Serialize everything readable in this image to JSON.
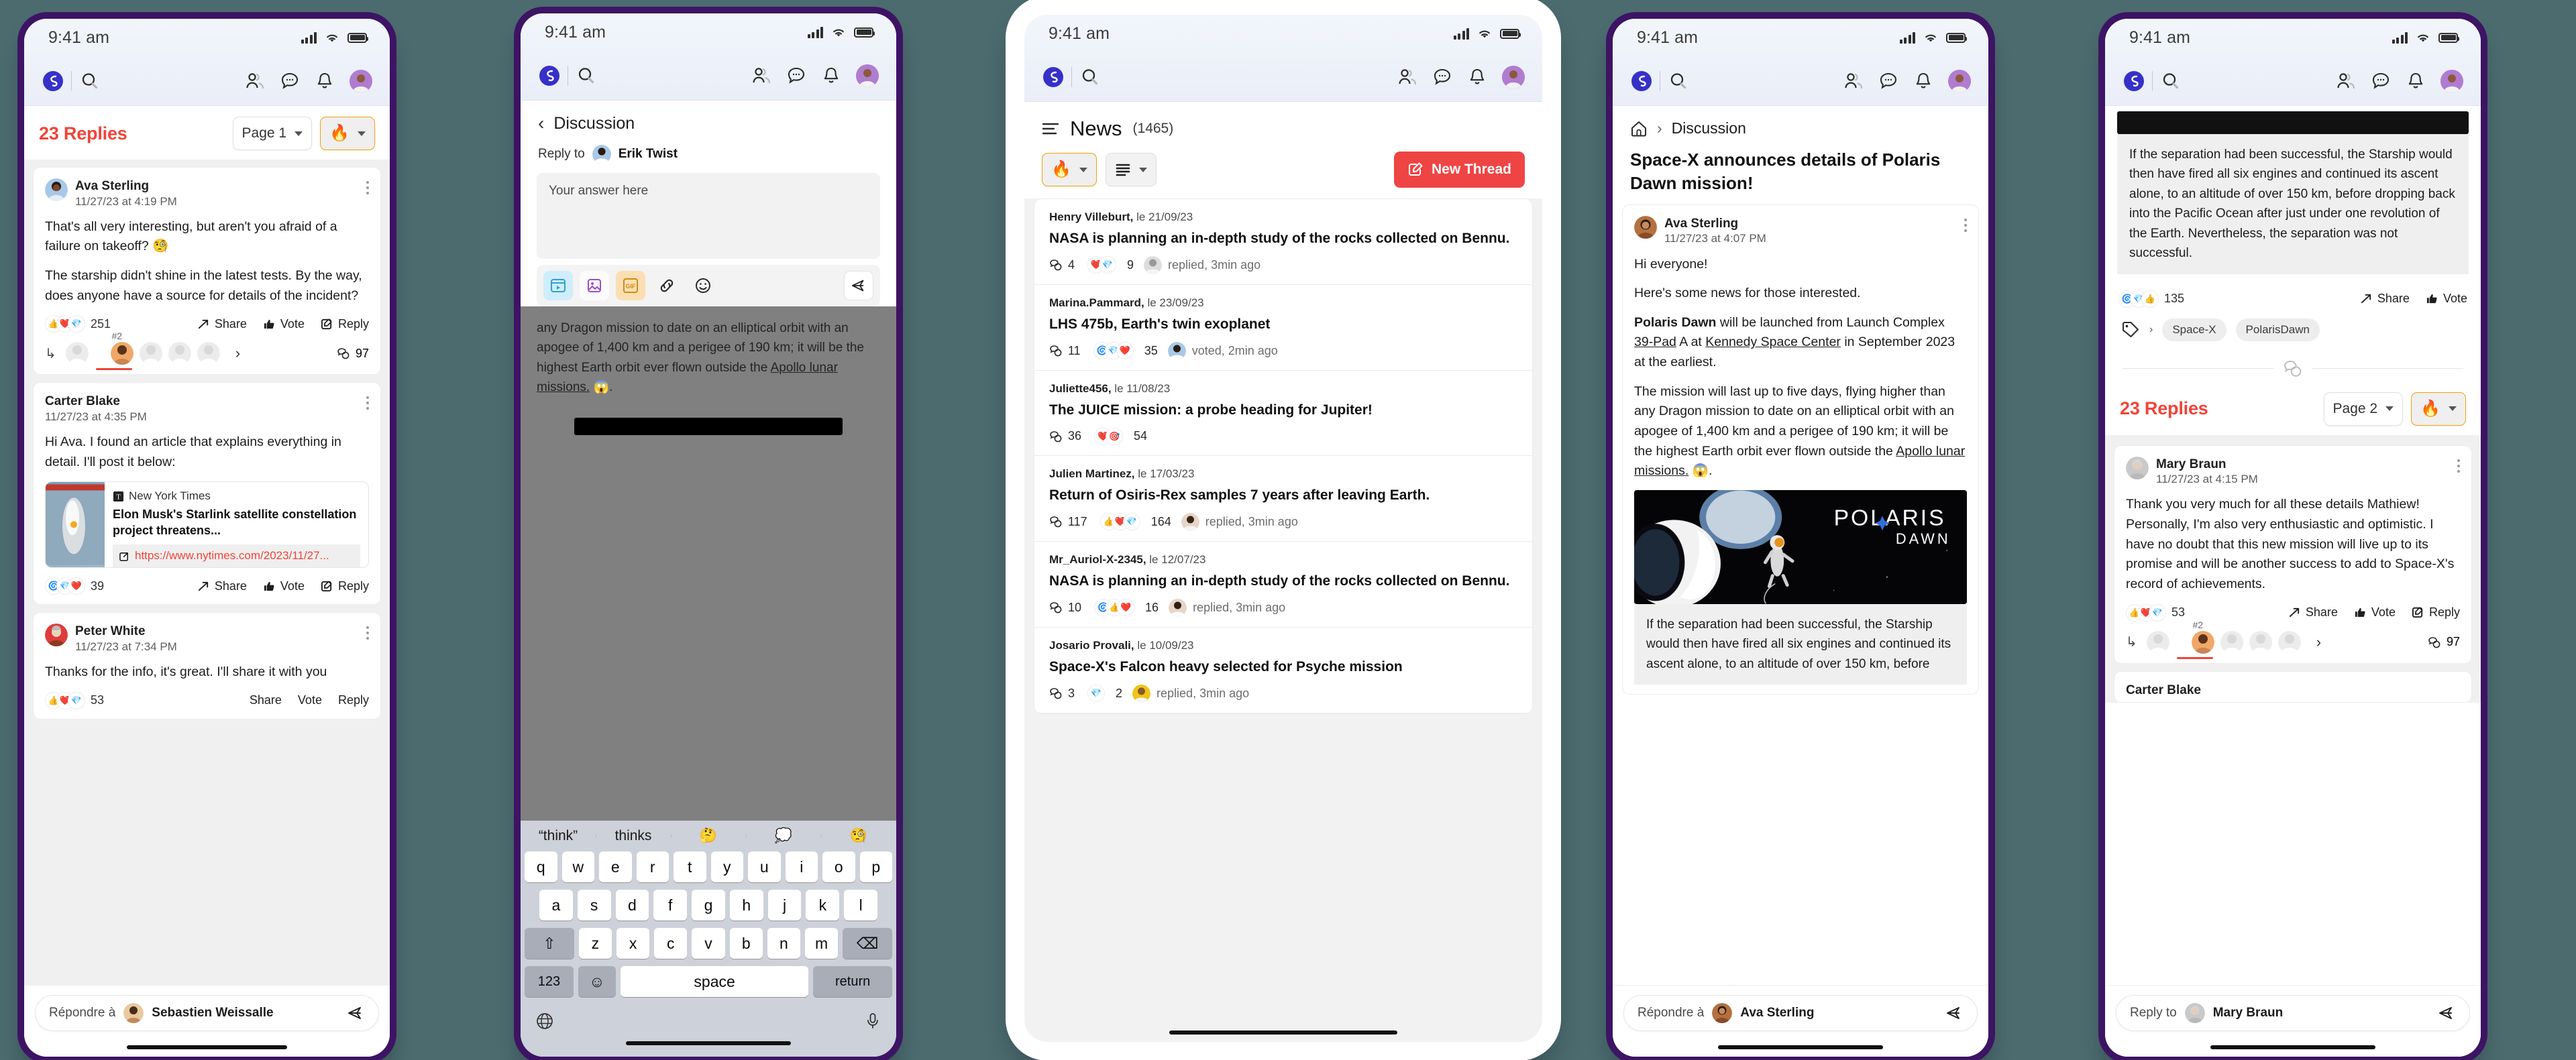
{
  "status_bar": {
    "time": "9:41 am"
  },
  "app_bar": {
    "logo_icon": "spiral-logo-icon",
    "search_icon": "search-icon",
    "people_icon": "people-icon",
    "messages_icon": "chat-bubble-icon",
    "notifications_icon": "bell-icon",
    "avatar_icon": "user-avatar"
  },
  "phone1": {
    "replies_label": "23 Replies",
    "page_select": "Page 1",
    "sort_icon": "flame-icon",
    "posts": [
      {
        "author": "Ava Sterling",
        "date": "11/27/23 at 4:19 PM",
        "paragraphs": [
          "That's all very interesting, but aren't you afraid of a failure on takeoff? 🧐",
          "The starship didn't shine in the latest tests. By the way, does anyone have a source for details of the incident?"
        ],
        "reaction_count": "251",
        "share_label": "Share",
        "vote_label": "Vote",
        "reply_label": "Reply",
        "strip_badge": "#2",
        "strip_count": "97"
      },
      {
        "author": "Carter Blake",
        "date": "11/27/23 at 4:35 PM",
        "paragraphs": [
          "Hi Ava. I found an article that explains everything in detail. I'll post it below:"
        ],
        "link": {
          "source": "New York Times",
          "title": "Elon Musk's Starlink satellite constellation project threatens...",
          "url": "https://www.nytimes.com/2023/11/27..."
        },
        "reaction_count": "39",
        "share_label": "Share",
        "vote_label": "Vote",
        "reply_label": "Reply"
      },
      {
        "author": "Peter White",
        "date": "11/27/23 at 7:34 PM",
        "paragraphs": [
          "Thanks for the info, it's great. I'll share it with you"
        ],
        "reaction_count": "53",
        "share_label": "Share",
        "vote_label": "Vote",
        "reply_label": "Reply"
      }
    ],
    "composer": {
      "label": "Répondre à",
      "name": "Sebastien Weissalle",
      "send_icon": "send-icon"
    }
  },
  "phone2": {
    "back_icon": "chevron-left-icon",
    "page_title": "Discussion",
    "reply_to_label": "Reply to",
    "reply_to_name": "Erik Twist",
    "editor_placeholder": "Your answer here",
    "tools": [
      "video-icon",
      "image-icon",
      "gif-icon",
      "link-icon",
      "emoji-icon",
      "send-icon"
    ],
    "dimmed_text": "any Dragon mission to date on an elliptical orbit with an apogee of 1,400 km and a perigee of 190 km; it will be the highest Earth orbit ever flown outside the ",
    "dimmed_link": "Apollo lunar missions.",
    "dimmed_emoji": " 😱.",
    "keyboard": {
      "suggestions": [
        "“think”",
        "thinks",
        "🤔",
        "💭",
        "🧐"
      ],
      "row1": [
        "q",
        "w",
        "e",
        "r",
        "t",
        "y",
        "u",
        "i",
        "o",
        "p"
      ],
      "row2": [
        "a",
        "s",
        "d",
        "f",
        "g",
        "h",
        "j",
        "k",
        "l"
      ],
      "row3": [
        "z",
        "x",
        "c",
        "v",
        "b",
        "n",
        "m"
      ],
      "shift_icon": "shift-icon",
      "backspace_icon": "backspace-icon",
      "numbers_key": "123",
      "emoji_key_icon": "emoji-keyboard-icon",
      "space_key": "space",
      "return_key": "return",
      "globe_icon": "globe-icon",
      "mic_icon": "microphone-icon"
    }
  },
  "phone3": {
    "list_icon": "list-lines-icon",
    "title": "News",
    "count": "(1465)",
    "sort_icon": "flame-icon",
    "view_icon": "list-view-icon",
    "new_thread_label": "New Thread",
    "new_thread_icon": "compose-icon",
    "threads": [
      {
        "author": "Henry Villeburt,",
        "date": "le 21/09/23",
        "title": "NASA is planning an in-depth study of the rocks collected on Bennu.",
        "comments": "4",
        "reactions": "9",
        "status": "replied, 3min ago"
      },
      {
        "author": "Marina.Pammard,",
        "date": "le 23/09/23",
        "title": "LHS 475b, Earth's twin exoplanet",
        "comments": "11",
        "reactions": "35",
        "status": "voted, 2min ago"
      },
      {
        "author": "Juliette456,",
        "date": "le 11/08/23",
        "title": "The JUICE mission: a probe heading for Jupiter!",
        "comments": "36",
        "reactions": "54",
        "status": ""
      },
      {
        "author": "Julien Martinez,",
        "date": "le 17/03/23",
        "title": "Return of Osiris-Rex samples 7 years after leaving Earth.",
        "comments": "117",
        "reactions": "164",
        "status": "replied, 3min ago"
      },
      {
        "author": "Mr_Auriol-X-2345,",
        "date": "le 12/07/23",
        "title": "NASA is planning an in-depth study of the rocks collected on Bennu.",
        "comments": "10",
        "reactions": "16",
        "status": "replied, 3min ago"
      },
      {
        "author": "Josario Provali,",
        "date": "le 10/09/23",
        "title": "Space-X's Falcon heavy selected for Psyche mission",
        "comments": "3",
        "reactions": "2",
        "status": "replied, 3min ago"
      }
    ]
  },
  "phone4": {
    "home_icon": "home-icon",
    "breadcrumb": "Discussion",
    "title": "Space-X announces details of Polaris Dawn mission!",
    "author": "Ava Sterling",
    "date": "11/27/23 at 4:07 PM",
    "paragraphs": [
      "Hi everyone!",
      "Here's some news for those interested."
    ],
    "p3_bold": "Polaris Dawn",
    "p3_rest1": " will be launched from Launch Complex ",
    "p3_link1": "39-Pad",
    "p3_rest2": " A at ",
    "p3_link2": "Kennedy Space Center",
    "p3_rest3": " in September 2023 at the earliest.",
    "p4": "The mission will last up to five days, flying higher than any Dragon mission to date on an elliptical orbit with an apogee of 1,400 km and a perigee of 190 km; it will be the highest Earth orbit ever flown outside the ",
    "p4_link": "Apollo lunar missions.",
    "p4_emoji": " 😱.",
    "hero_title": "POLARIS",
    "hero_subtitle": "DAWN",
    "quote": "If the separation had been successful, the Starship would then have fired all six engines and continued its ascent alone, to an altitude of over 150 km, before",
    "composer": {
      "label": "Répondre à",
      "name": "Ava Sterling",
      "send_icon": "send-icon"
    }
  },
  "phone5": {
    "quote": "If the separation had been successful, the Starship would then have fired all six engines and continued its ascent alone, to an altitude of over 150 km, before dropping back into the Pacific Ocean after just under one revolution of the Earth. Nevertheless, the separation was not successful.",
    "reaction_count": "135",
    "share_label": "Share",
    "vote_label": "Vote",
    "tag_icon": "tag-icon",
    "tags": [
      "Space-X",
      "PolarisDawn"
    ],
    "divider_icon": "chat-bubbles-icon",
    "replies_label": "23 Replies",
    "page_select": "Page 2",
    "sort_icon": "flame-icon",
    "post": {
      "author": "Mary Braun",
      "date": "11/27/23 at 4:15 PM",
      "text": "Thank you very much for all these details Mathiew! Personally, I'm also very enthusiastic and optimistic. I have no doubt that this new mission will live up to its promise and will be another success to add to Space-X's record of achievements.",
      "reaction_count": "53",
      "share_label": "Share",
      "vote_label": "Vote",
      "reply_label": "Reply",
      "strip_badge": "#2",
      "strip_count": "97"
    },
    "next_author": "Carter Blake",
    "composer": {
      "label": "Reply to",
      "name": "Mary Braun",
      "send_icon": "send-icon"
    }
  },
  "colors": {
    "frame": "#3d1464",
    "background": "#4b6b6f",
    "accent_red": "#f04438",
    "primary_red": "#ef4444",
    "flame_orange": "#f0a20d",
    "logo_blue": "#3730c8"
  }
}
